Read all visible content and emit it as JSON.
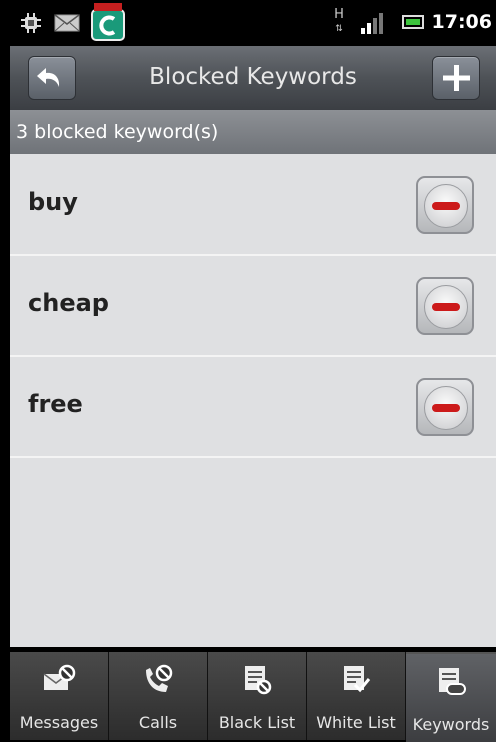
{
  "status_bar": {
    "time": "17:06",
    "network_label": "H",
    "icons": [
      "android-system-icon",
      "mail-icon",
      "comodo-app-icon",
      "network-h-icon",
      "signal-bars-icon",
      "battery-icon"
    ]
  },
  "header": {
    "title": "Blocked Keywords",
    "back_icon": "back-arrow-icon",
    "add_icon": "plus-icon"
  },
  "summary": {
    "count_text": "3 blocked keyword(s)"
  },
  "keywords": [
    {
      "label": "buy"
    },
    {
      "label": "cheap"
    },
    {
      "label": "free"
    }
  ],
  "tabs": [
    {
      "label": "Messages",
      "icon": "messages-block-icon"
    },
    {
      "label": "Calls",
      "icon": "calls-block-icon"
    },
    {
      "label": "Black List",
      "icon": "black-list-icon"
    },
    {
      "label": "White List",
      "icon": "white-list-icon"
    },
    {
      "label": "Keywords",
      "icon": "keywords-icon",
      "active": true
    }
  ],
  "colors": {
    "delete_accent": "#cc1a1a",
    "list_background": "#dfe0e2",
    "header_background": "#4e5257"
  }
}
